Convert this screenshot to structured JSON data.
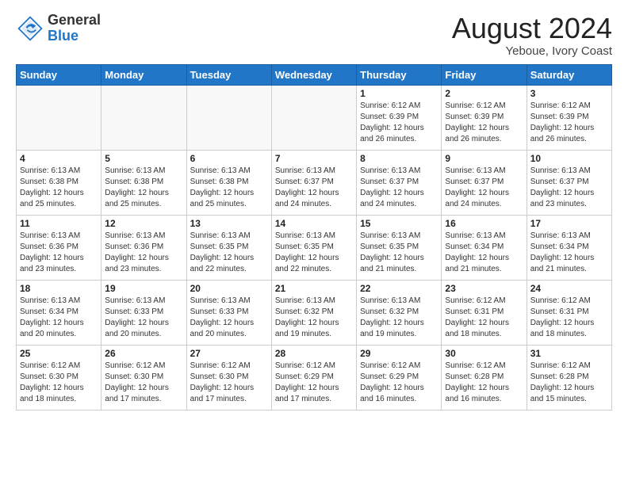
{
  "header": {
    "logo_general": "General",
    "logo_blue": "Blue",
    "month_title": "August 2024",
    "location": "Yeboue, Ivory Coast"
  },
  "weekdays": [
    "Sunday",
    "Monday",
    "Tuesday",
    "Wednesday",
    "Thursday",
    "Friday",
    "Saturday"
  ],
  "weeks": [
    [
      {
        "day": "",
        "info": ""
      },
      {
        "day": "",
        "info": ""
      },
      {
        "day": "",
        "info": ""
      },
      {
        "day": "",
        "info": ""
      },
      {
        "day": "1",
        "info": "Sunrise: 6:12 AM\nSunset: 6:39 PM\nDaylight: 12 hours\nand 26 minutes."
      },
      {
        "day": "2",
        "info": "Sunrise: 6:12 AM\nSunset: 6:39 PM\nDaylight: 12 hours\nand 26 minutes."
      },
      {
        "day": "3",
        "info": "Sunrise: 6:12 AM\nSunset: 6:39 PM\nDaylight: 12 hours\nand 26 minutes."
      }
    ],
    [
      {
        "day": "4",
        "info": "Sunrise: 6:13 AM\nSunset: 6:38 PM\nDaylight: 12 hours\nand 25 minutes."
      },
      {
        "day": "5",
        "info": "Sunrise: 6:13 AM\nSunset: 6:38 PM\nDaylight: 12 hours\nand 25 minutes."
      },
      {
        "day": "6",
        "info": "Sunrise: 6:13 AM\nSunset: 6:38 PM\nDaylight: 12 hours\nand 25 minutes."
      },
      {
        "day": "7",
        "info": "Sunrise: 6:13 AM\nSunset: 6:37 PM\nDaylight: 12 hours\nand 24 minutes."
      },
      {
        "day": "8",
        "info": "Sunrise: 6:13 AM\nSunset: 6:37 PM\nDaylight: 12 hours\nand 24 minutes."
      },
      {
        "day": "9",
        "info": "Sunrise: 6:13 AM\nSunset: 6:37 PM\nDaylight: 12 hours\nand 24 minutes."
      },
      {
        "day": "10",
        "info": "Sunrise: 6:13 AM\nSunset: 6:37 PM\nDaylight: 12 hours\nand 23 minutes."
      }
    ],
    [
      {
        "day": "11",
        "info": "Sunrise: 6:13 AM\nSunset: 6:36 PM\nDaylight: 12 hours\nand 23 minutes."
      },
      {
        "day": "12",
        "info": "Sunrise: 6:13 AM\nSunset: 6:36 PM\nDaylight: 12 hours\nand 23 minutes."
      },
      {
        "day": "13",
        "info": "Sunrise: 6:13 AM\nSunset: 6:35 PM\nDaylight: 12 hours\nand 22 minutes."
      },
      {
        "day": "14",
        "info": "Sunrise: 6:13 AM\nSunset: 6:35 PM\nDaylight: 12 hours\nand 22 minutes."
      },
      {
        "day": "15",
        "info": "Sunrise: 6:13 AM\nSunset: 6:35 PM\nDaylight: 12 hours\nand 21 minutes."
      },
      {
        "day": "16",
        "info": "Sunrise: 6:13 AM\nSunset: 6:34 PM\nDaylight: 12 hours\nand 21 minutes."
      },
      {
        "day": "17",
        "info": "Sunrise: 6:13 AM\nSunset: 6:34 PM\nDaylight: 12 hours\nand 21 minutes."
      }
    ],
    [
      {
        "day": "18",
        "info": "Sunrise: 6:13 AM\nSunset: 6:34 PM\nDaylight: 12 hours\nand 20 minutes."
      },
      {
        "day": "19",
        "info": "Sunrise: 6:13 AM\nSunset: 6:33 PM\nDaylight: 12 hours\nand 20 minutes."
      },
      {
        "day": "20",
        "info": "Sunrise: 6:13 AM\nSunset: 6:33 PM\nDaylight: 12 hours\nand 20 minutes."
      },
      {
        "day": "21",
        "info": "Sunrise: 6:13 AM\nSunset: 6:32 PM\nDaylight: 12 hours\nand 19 minutes."
      },
      {
        "day": "22",
        "info": "Sunrise: 6:13 AM\nSunset: 6:32 PM\nDaylight: 12 hours\nand 19 minutes."
      },
      {
        "day": "23",
        "info": "Sunrise: 6:12 AM\nSunset: 6:31 PM\nDaylight: 12 hours\nand 18 minutes."
      },
      {
        "day": "24",
        "info": "Sunrise: 6:12 AM\nSunset: 6:31 PM\nDaylight: 12 hours\nand 18 minutes."
      }
    ],
    [
      {
        "day": "25",
        "info": "Sunrise: 6:12 AM\nSunset: 6:30 PM\nDaylight: 12 hours\nand 18 minutes."
      },
      {
        "day": "26",
        "info": "Sunrise: 6:12 AM\nSunset: 6:30 PM\nDaylight: 12 hours\nand 17 minutes."
      },
      {
        "day": "27",
        "info": "Sunrise: 6:12 AM\nSunset: 6:30 PM\nDaylight: 12 hours\nand 17 minutes."
      },
      {
        "day": "28",
        "info": "Sunrise: 6:12 AM\nSunset: 6:29 PM\nDaylight: 12 hours\nand 17 minutes."
      },
      {
        "day": "29",
        "info": "Sunrise: 6:12 AM\nSunset: 6:29 PM\nDaylight: 12 hours\nand 16 minutes."
      },
      {
        "day": "30",
        "info": "Sunrise: 6:12 AM\nSunset: 6:28 PM\nDaylight: 12 hours\nand 16 minutes."
      },
      {
        "day": "31",
        "info": "Sunrise: 6:12 AM\nSunset: 6:28 PM\nDaylight: 12 hours\nand 15 minutes."
      }
    ]
  ]
}
